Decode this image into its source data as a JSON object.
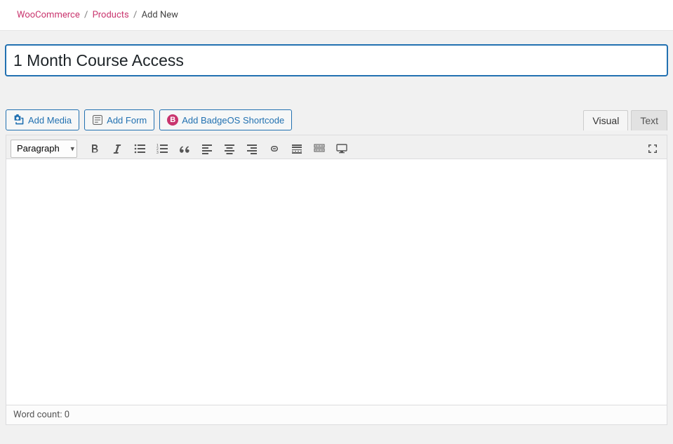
{
  "breadcrumb": {
    "woo": "WooCommerce",
    "products": "Products",
    "current": "Add New"
  },
  "editor": {
    "title_value": "1 Month Course Access",
    "format_option": "Paragraph"
  },
  "buttons": {
    "add_media": "Add Media",
    "add_form": "Add Form",
    "add_badgeos": "Add BadgeOS Shortcode"
  },
  "tabs": {
    "visual": "Visual",
    "text": "Text"
  },
  "statusbar": {
    "word_count_label": "Word count: ",
    "word_count_value": "0"
  }
}
